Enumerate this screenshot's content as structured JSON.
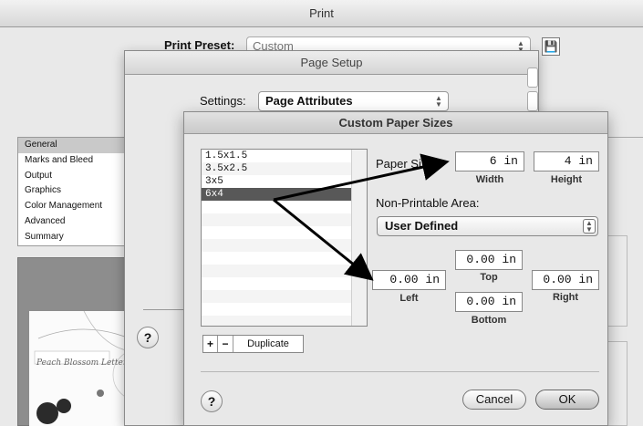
{
  "print_window": {
    "title": "Print",
    "preset_label": "Print Preset:",
    "preset_value": "Custom",
    "sidebar": [
      "General",
      "Marks and Bleed",
      "Output",
      "Graphics",
      "Color Management",
      "Advanced",
      "Summary"
    ],
    "preview_card_title": "Peach Blossom Letter"
  },
  "page_setup": {
    "title": "Page Setup",
    "settings_label": "Settings:",
    "settings_value": "Page Attributes",
    "help": "?"
  },
  "custom_paper_sizes": {
    "title": "Custom Paper Sizes",
    "sizes": [
      "1.5x1.5",
      "3.5x2.5",
      "3x5",
      "6x4"
    ],
    "selected_size": "6x4",
    "add_label": "+",
    "remove_label": "−",
    "duplicate_label": "Duplicate",
    "paper_size_label": "Paper Size:",
    "width_value": "6 in",
    "width_caption": "Width",
    "height_value": "4 in",
    "height_caption": "Height",
    "npa_label": "Non-Printable Area:",
    "npa_value": "User Defined",
    "top_value": "0.00 in",
    "top_caption": "Top",
    "left_value": "0.00 in",
    "left_caption": "Left",
    "bottom_value": "0.00 in",
    "bottom_caption": "Bottom",
    "right_value": "0.00 in",
    "right_caption": "Right",
    "help": "?",
    "cancel_label": "Cancel",
    "ok_label": "OK"
  },
  "icons": {
    "save": "floppy-disk-icon",
    "help": "question-mark-icon",
    "popup_arrows": "up-down-arrows-icon"
  }
}
